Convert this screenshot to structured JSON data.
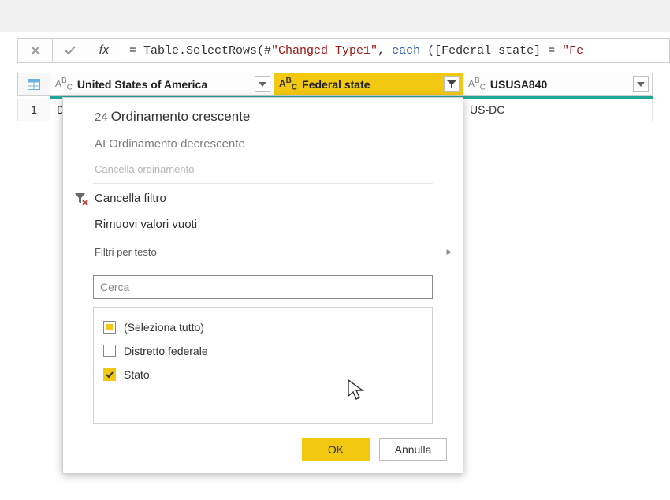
{
  "formula_bar": {
    "fx_label": "fx",
    "prefix": "= Table.SelectRows(#",
    "string1": "\"Changed Type1\"",
    "mid": ", ",
    "each_kw": "each",
    "mid2": " ([Federal state] = ",
    "string2": "\"Fe"
  },
  "columns": [
    {
      "type_icon": "ABC",
      "label": "United States of America"
    },
    {
      "type_icon": "ABC",
      "label": "Federal state"
    },
    {
      "type_icon": "ABC",
      "label": "USUSA840"
    }
  ],
  "rows": [
    {
      "index": "1",
      "c0": "D",
      "c2": "US-DC"
    }
  ],
  "filter_popup": {
    "sort_asc_num": "24",
    "sort_asc_label": "Ordinamento crescente",
    "sort_desc_prefix": "AI",
    "sort_desc_label": "Ordinamento decrescente",
    "clear_sort": "Cancella ordinamento",
    "clear_filter": "Cancella filtro",
    "remove_empty": "Rimuovi valori vuoti",
    "text_filters": "Filtri per testo",
    "search_placeholder": "Cerca",
    "list": [
      {
        "state": "indeterminate",
        "label": "(Seleziona tutto)"
      },
      {
        "state": "unchecked",
        "label": "Distretto federale"
      },
      {
        "state": "checked",
        "label": "Stato"
      }
    ],
    "ok": "OK",
    "cancel": "Annulla"
  }
}
